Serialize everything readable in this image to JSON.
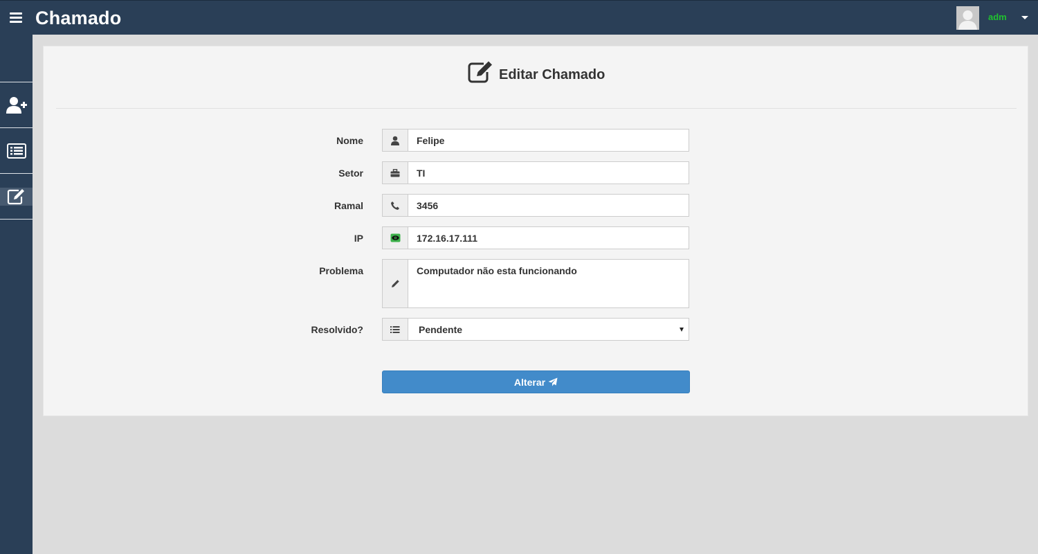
{
  "app": {
    "brand": "Chamado"
  },
  "user": {
    "name": "adm",
    "name_color": "#20c12f"
  },
  "sidebar": {
    "items": [
      {
        "icon": "add-user-icon"
      },
      {
        "icon": "list-icon"
      },
      {
        "icon": "edit-icon",
        "active": true
      }
    ]
  },
  "panel": {
    "title": "Editar Chamado",
    "title_icon": "edit-square-icon"
  },
  "form": {
    "nome": {
      "label": "Nome",
      "value": "Felipe",
      "icon": "user-icon"
    },
    "setor": {
      "label": "Setor",
      "value": "TI",
      "icon": "briefcase-icon"
    },
    "ramal": {
      "label": "Ramal",
      "value": "3456",
      "icon": "phone-icon"
    },
    "ip": {
      "label": "IP",
      "value": "172.16.17.111",
      "icon": "eye-icon"
    },
    "problema": {
      "label": "Problema",
      "value": "Computador não esta funcionando",
      "icon": "pencil-icon"
    },
    "resolvido": {
      "label": "Resolvido?",
      "value": "Pendente",
      "icon": "list-icon"
    },
    "submit_label": "Alterar",
    "submit_icon": "send-icon"
  },
  "colors": {
    "topbar": "#2a3f57",
    "button": "#428bca",
    "background": "#dcdcdc"
  }
}
